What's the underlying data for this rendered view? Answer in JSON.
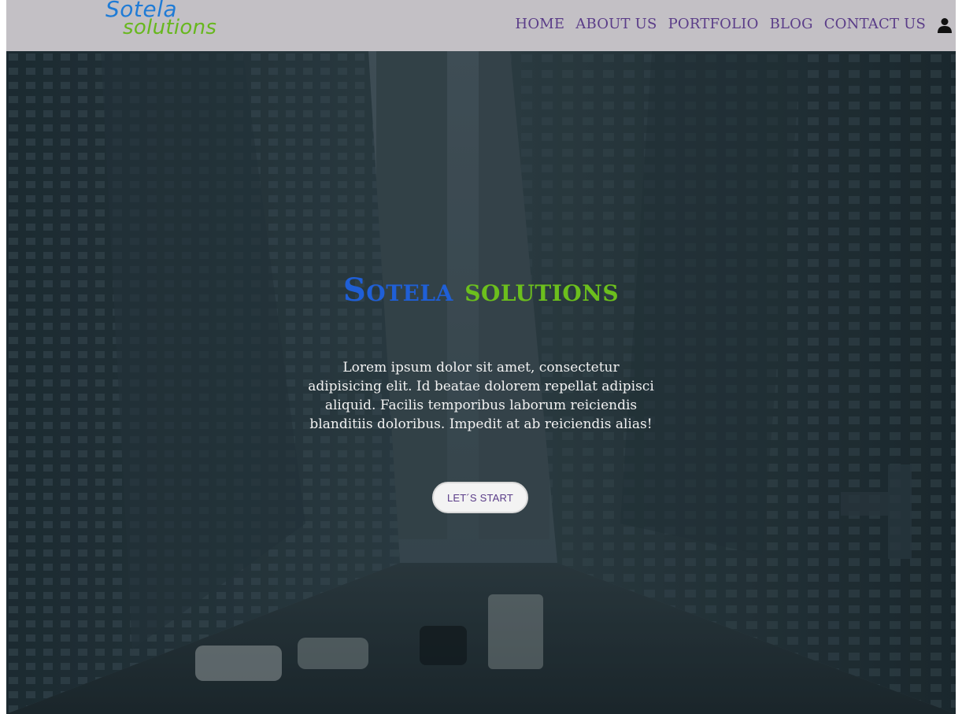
{
  "brand": {
    "logo_line1": "Sotela",
    "logo_line2": "solutions",
    "colors": {
      "blue": "#1f5fd6",
      "green": "#6cbf1d",
      "nav_text": "#5a3c88",
      "navbar_bg": "#c3c0c5"
    }
  },
  "nav": {
    "items": [
      {
        "label": "HOME"
      },
      {
        "label": "ABOUT US"
      },
      {
        "label": "PORTFOLIO"
      },
      {
        "label": "BLOG"
      },
      {
        "label": "CONTACT US"
      }
    ],
    "user_icon": "user-icon"
  },
  "hero": {
    "title_part1": "Sotela",
    "title_part2": "solutions",
    "text": "Lorem ipsum dolor sit amet, consectetur adipisicing elit. Id beatae dolorem repellat adipisci aliquid. Facilis temporibus laborum reiciendis blanditiis doloribus. Impedit at ab reiciendis alias!",
    "cta_label": "LET´S START"
  }
}
